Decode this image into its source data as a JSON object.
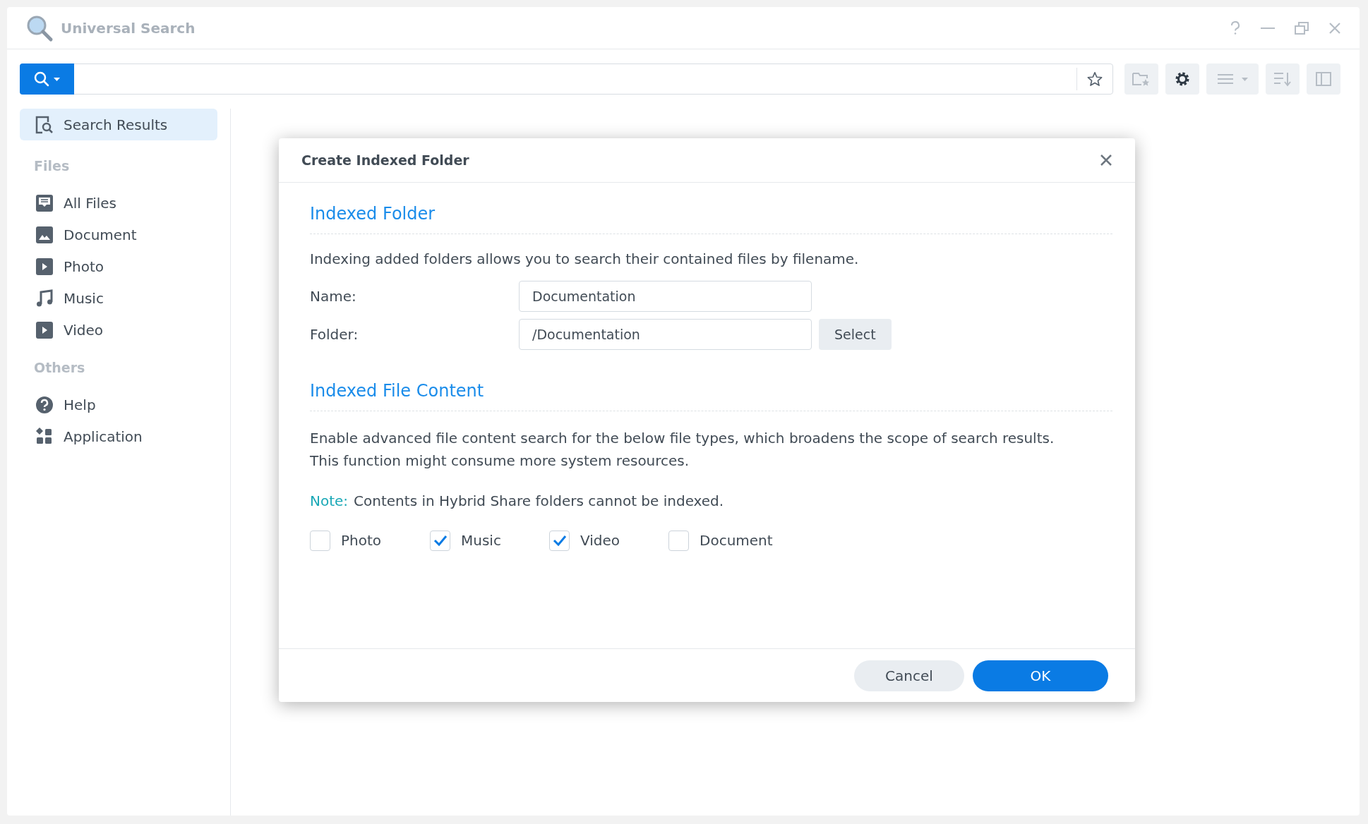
{
  "window": {
    "title": "Universal Search"
  },
  "sidebar": {
    "top_item": {
      "label": "Search Results",
      "selected": true
    },
    "sections": [
      {
        "heading": "Files",
        "items": [
          {
            "label": "All Files",
            "kind": "allfiles"
          },
          {
            "label": "Document",
            "kind": "image"
          },
          {
            "label": "Photo",
            "kind": "play"
          },
          {
            "label": "Music",
            "kind": "music"
          },
          {
            "label": "Video",
            "kind": "play"
          }
        ]
      },
      {
        "heading": "Others",
        "items": [
          {
            "label": "Help",
            "kind": "help"
          },
          {
            "label": "Application",
            "kind": "apps"
          }
        ]
      }
    ]
  },
  "dialog": {
    "title": "Create Indexed Folder",
    "folder_section": {
      "heading": "Indexed Folder",
      "description": "Indexing added folders allows you to search their contained files by filename.",
      "fields": [
        {
          "label": "Name:",
          "value": "Documentation"
        },
        {
          "label": "Folder:",
          "value": "/Documentation",
          "button": "Select"
        }
      ]
    },
    "content_section": {
      "heading": "Indexed File Content",
      "description_lines": [
        "Enable advanced file content search for the below file types, which broadens the scope of search results.",
        "This function might consume more system resources."
      ],
      "note": {
        "label": "Note:",
        "text": "Contents in Hybrid Share folders cannot be indexed."
      },
      "checkboxes": [
        {
          "label": "Photo",
          "checked": false
        },
        {
          "label": "Music",
          "checked": true
        },
        {
          "label": "Video",
          "checked": true
        },
        {
          "label": "Document",
          "checked": false
        }
      ]
    },
    "buttons": [
      {
        "label": "Cancel",
        "kind": "secondary"
      },
      {
        "label": "OK",
        "kind": "primary"
      }
    ]
  }
}
